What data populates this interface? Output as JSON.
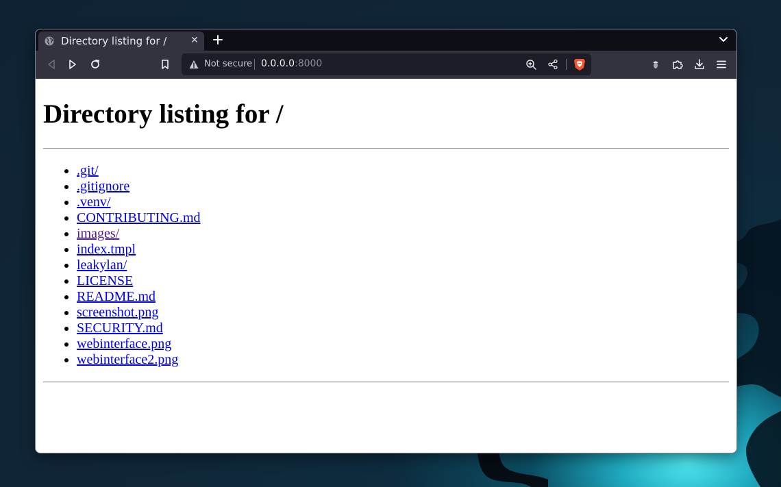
{
  "browser": {
    "tab": {
      "title": "Directory listing for /",
      "icon": "globe-icon"
    },
    "toolbar": {
      "security_label": "Not secure",
      "url_host": "0.0.0.0",
      "url_port": ":8000"
    }
  },
  "page": {
    "heading": "Directory listing for /",
    "entries": [
      {
        "label": ".git/",
        "visited": false
      },
      {
        "label": ".gitignore",
        "visited": false
      },
      {
        "label": ".venv/",
        "visited": false
      },
      {
        "label": "CONTRIBUTING.md",
        "visited": false
      },
      {
        "label": "images/",
        "visited": true
      },
      {
        "label": "index.tmpl",
        "visited": false
      },
      {
        "label": "leakylan/",
        "visited": false
      },
      {
        "label": "LICENSE",
        "visited": false
      },
      {
        "label": "README.md",
        "visited": false
      },
      {
        "label": "screenshot.png",
        "visited": false
      },
      {
        "label": "SECURITY.md",
        "visited": false
      },
      {
        "label": "webinterface.png",
        "visited": false
      },
      {
        "label": "webinterface2.png",
        "visited": false
      }
    ]
  },
  "colors": {
    "link": "#0000ee",
    "visited_link": "#551a8b",
    "tabbar": "#0d0e16",
    "toolbar": "#33333f",
    "urlbar": "#1d1d27",
    "brave_orange": "#fb542b"
  }
}
